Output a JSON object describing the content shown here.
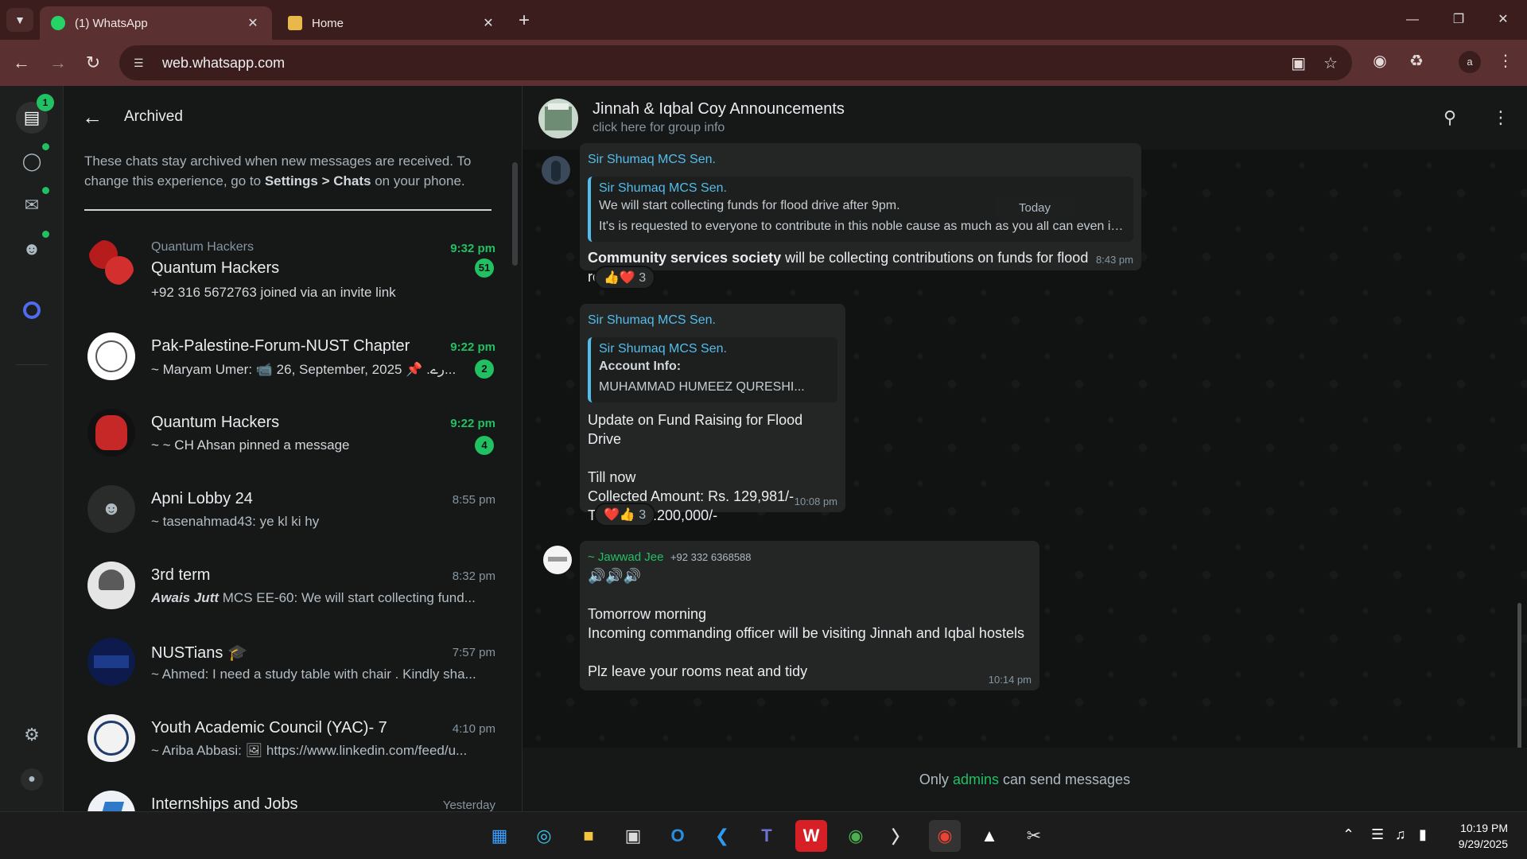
{
  "browser": {
    "tabs": [
      {
        "title": "(1) WhatsApp",
        "active": true
      },
      {
        "title": "Home",
        "active": false
      }
    ],
    "url": "web.whatsapp.com"
  },
  "rail": {
    "chats_badge": "1"
  },
  "archived": {
    "title": "Archived",
    "note_prefix": "These chats stay archived when new messages are received. To change this experience, go to ",
    "note_bold1": "Settings",
    "note_sep": " > ",
    "note_bold2": "Chats",
    "note_suffix": " on your phone.",
    "chats": [
      {
        "community": "Quantum Hackers",
        "name": "Quantum Hackers",
        "time": "9:32 pm",
        "unread": "51",
        "preview": "+92 316 5672763 joined via an invite link"
      },
      {
        "name": "Pak-Palestine-Forum-NUST Chapter",
        "time": "9:22 pm",
        "unread": "2",
        "preview": "~ Maryam Umer: 📹 26, September, 2025 📌 .رے..."
      },
      {
        "name": "Quantum Hackers",
        "time": "9:22 pm",
        "unread": "4",
        "preview": "~ ~ CH Ahsan pinned a message"
      },
      {
        "name": "Apni Lobby 24",
        "time": "8:55 pm",
        "preview": "~ tasenahmad43: ye kl ki hy"
      },
      {
        "name": "3rd term",
        "time": "8:32 pm",
        "preview_bold": "Awais Jutt",
        "preview": " MCS EE-60: We will start collecting fund..."
      },
      {
        "name": "NUSTians 🎓",
        "time": "7:57 pm",
        "preview": "~ Ahmed: I need a study table with chair . Kindly sha..."
      },
      {
        "name": "Youth Academic Council (YAC)- 7",
        "time": "4:10 pm",
        "preview": "~ Ariba Abbasi: 🖼 https://www.linkedin.com/feed/u..."
      },
      {
        "name": "Internships and Jobs",
        "time": "Yesterday",
        "preview": ""
      }
    ]
  },
  "conversation": {
    "title": "Jinnah & Iqbal Coy Announcements",
    "subtitle": "click here for group info",
    "date_pill": "Today",
    "messages": [
      {
        "sender": "Sir Shumaq MCS Sen.",
        "quote_name": "Sir Shumaq MCS Sen.",
        "quote_line1": "We will start collecting funds for flood drive after 9pm.",
        "quote_line2": "It's is requested to everyone to contribute in this noble cause as much as you all can even  if ...",
        "text_bold": "Community services society",
        "text": " will be collecting contributions on funds for flood refugees.",
        "time": "8:43 pm",
        "reactions": "👍❤️ 3"
      },
      {
        "sender": "Sir Shumaq MCS Sen.",
        "quote_name": "Sir Shumaq MCS Sen.",
        "quote_line1": "Account Info:",
        "quote_line2": "MUHAMMAD HUMEEZ QURESHI...",
        "lines": [
          "Update on Fund Raising for Flood Drive",
          "",
          "Till now",
          "Collected Amount: Rs. 129,981/-",
          "Target: Rs.200,000/-"
        ],
        "time": "10:08 pm",
        "reactions": "❤️👍 3"
      },
      {
        "sender": "~ Jawwad Jee",
        "phone": "+92 332 6368588",
        "lines": [
          "🔊🔊🔊",
          "",
          "Tomorrow morning",
          "Incoming commanding officer will be visiting Jinnah and Iqbal hostels",
          "",
          "Plz leave your rooms neat and tidy"
        ],
        "time": "10:14 pm"
      }
    ],
    "footer_prefix": "Only ",
    "footer_link": "admins",
    "footer_suffix": " can send messages"
  },
  "taskbar": {
    "time": "10:19 PM",
    "date": "9/29/2025"
  }
}
